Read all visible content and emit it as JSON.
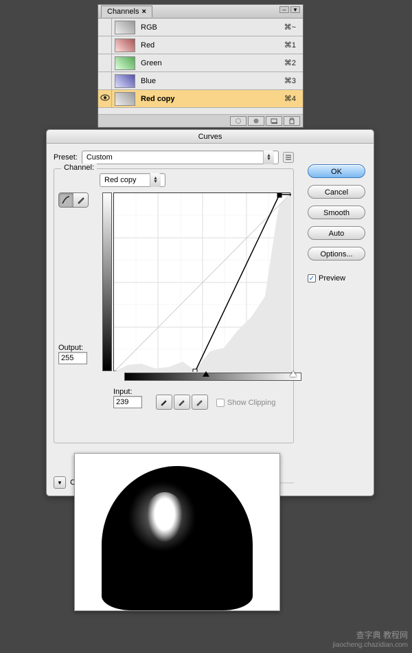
{
  "channels_panel": {
    "tab_label": "Channels",
    "rows": [
      {
        "name": "RGB",
        "shortcut": "⌘~",
        "visible": false,
        "selected": false,
        "tint": "rgb"
      },
      {
        "name": "Red",
        "shortcut": "⌘1",
        "visible": false,
        "selected": false,
        "tint": "red"
      },
      {
        "name": "Green",
        "shortcut": "⌘2",
        "visible": false,
        "selected": false,
        "tint": "green"
      },
      {
        "name": "Blue",
        "shortcut": "⌘3",
        "visible": false,
        "selected": false,
        "tint": "blue"
      },
      {
        "name": "Red copy",
        "shortcut": "⌘4",
        "visible": true,
        "selected": true,
        "tint": "rgb"
      }
    ]
  },
  "curves": {
    "title": "Curves",
    "preset_label": "Preset:",
    "preset_value": "Custom",
    "channel_label": "Channel:",
    "channel_value": "Red copy",
    "output_label": "Output:",
    "output_value": "255",
    "input_label": "Input:",
    "input_value": "239",
    "show_clipping_label": "Show Clipping",
    "curve_display_options": "Curve Display Options",
    "buttons": {
      "ok": "OK",
      "cancel": "Cancel",
      "smooth": "Smooth",
      "auto": "Auto",
      "options": "Options..."
    },
    "preview_label": "Preview",
    "preview_checked": true
  },
  "chart_data": {
    "type": "line",
    "title": "Curves",
    "xlabel": "Input",
    "ylabel": "Output",
    "xlim": [
      0,
      255
    ],
    "ylim": [
      0,
      255
    ],
    "curve_points": [
      {
        "x": 117,
        "y": 0
      },
      {
        "x": 239,
        "y": 255
      }
    ],
    "baseline": [
      {
        "x": 0,
        "y": 0
      },
      {
        "x": 255,
        "y": 255
      }
    ],
    "black_slider": 117,
    "white_slider": 239
  },
  "watermark": {
    "main": "查字典 教程网",
    "sub": "jiaocheng.chazidian.com"
  }
}
